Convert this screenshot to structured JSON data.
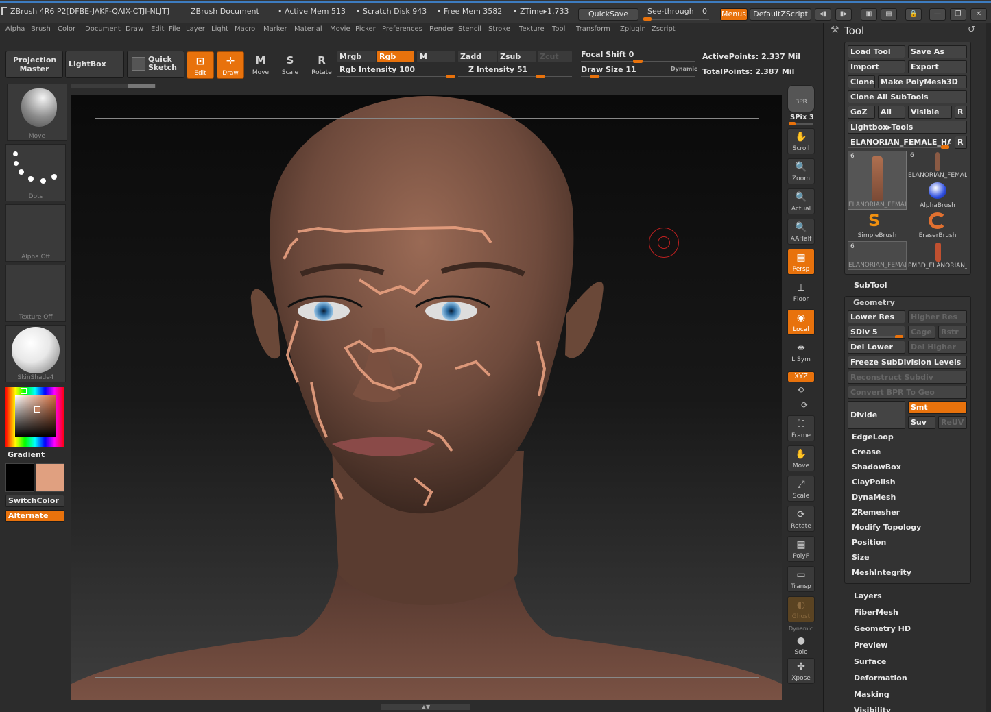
{
  "titlebar": {
    "app": "ZBrush 4R6 P2[DFBE-JAKF-QAIX-CTJI-NLJT]",
    "document": "ZBrush Document",
    "active_mem": "• Active Mem 513",
    "scratch_disk": "• Scratch Disk 943",
    "free_mem": "• Free Mem 3582",
    "ztime": "• ZTime▸1.733",
    "quicksave": "QuickSave",
    "see_through": "See-through",
    "see_through_value": "0",
    "menus": "Menus",
    "default_zscript": "DefaultZScript"
  },
  "menubar": [
    "Alpha",
    "Brush",
    "Color",
    "Document",
    "Draw",
    "Edit",
    "File",
    "Layer",
    "Light",
    "Macro",
    "Marker",
    "Material",
    "Movie",
    "Picker",
    "Preferences",
    "Render",
    "Stencil",
    "Stroke",
    "Texture",
    "Tool",
    "Transform",
    "Zplugin",
    "Zscript"
  ],
  "toolbar": {
    "projection_master": "Projection Master",
    "lightbox": "LightBox",
    "quick_sketch": "Quick Sketch",
    "edit": "Edit",
    "draw": "Draw",
    "move": "Move",
    "scale": "Scale",
    "rotate": "Rotate",
    "mrgb": "Mrgb",
    "rgb": "Rgb",
    "m": "M",
    "rgb_intensity": "Rgb Intensity 100",
    "zadd": "Zadd",
    "zsub": "Zsub",
    "zcut": "Zcut",
    "z_intensity": "Z Intensity 51",
    "focal_shift": "Focal Shift 0",
    "draw_size": "Draw Size 11",
    "dynamic": "Dynamic",
    "active_points": "ActivePoints: 2.337 Mil",
    "total_points": "TotalPoints: 2.387 Mil"
  },
  "left": {
    "brush_cap": "Move",
    "stroke_cap": "Dots",
    "alpha_cap": "Alpha Off",
    "texture_cap": "Texture Off",
    "material_cap": "SkinShade4",
    "gradient": "Gradient",
    "switch_color": "SwitchColor",
    "alternate": "Alternate",
    "main_color": "#000000",
    "secondary_color": "#e0a080"
  },
  "rshelf": {
    "bpr": "BPR",
    "spix": "SPix 3",
    "scroll": "Scroll",
    "zoom": "Zoom",
    "actual": "Actual",
    "aahalf": "AAHalf",
    "persp": "Persp",
    "floor": "Floor",
    "local": "Local",
    "lsym": "L.Sym",
    "xyz": "XYZ",
    "frame": "Frame",
    "move": "Move",
    "scale": "Scale",
    "rotate": "Rotate",
    "polyf": "PolyF",
    "transp": "Transp",
    "ghost": "Ghost",
    "dynamic": "Dynamic",
    "solo": "Solo",
    "xpose": "Xpose"
  },
  "tool": {
    "title": "Tool",
    "load_tool": "Load Tool",
    "save_as": "Save As",
    "import": "Import",
    "export": "Export",
    "clone": "Clone",
    "make_polymesh": "Make PolyMesh3D",
    "clone_all": "Clone All SubTools",
    "goz": "GoZ",
    "all": "All",
    "visible": "Visible",
    "r": "R",
    "lightbox_tools": "Lightbox▸Tools",
    "current_tool": "ELANORIAN_FEMALE_HAIR",
    "thumbs": [
      {
        "n": "6",
        "label": "ELANORIAN_FEMAL"
      },
      {
        "n": "6",
        "label": "ELANORIAN_FEMAL"
      },
      {
        "n": "",
        "label": "AlphaBrush"
      },
      {
        "n": "",
        "label": "SimpleBrush"
      },
      {
        "n": "",
        "label": "EraserBrush"
      },
      {
        "n": "6",
        "label": "ELANORIAN_FEMAL"
      },
      {
        "n": "",
        "label": "PM3D_ELANORIAN_"
      }
    ],
    "subtool": "SubTool",
    "geometry": "Geometry",
    "lower_res": "Lower Res",
    "higher_res": "Higher Res",
    "sdiv": "SDiv 5",
    "cage": "Cage",
    "rstr": "Rstr",
    "del_lower": "Del Lower",
    "del_higher": "Del Higher",
    "freeze": "Freeze SubDivision Levels",
    "reconstruct": "Reconstruct Subdiv",
    "convert_bpr": "Convert BPR To Geo",
    "divide": "Divide",
    "smt": "Smt",
    "suv": "Suv",
    "reuv": "ReUV",
    "geo_items": [
      "EdgeLoop",
      "Crease",
      "ShadowBox",
      "ClayPolish",
      "DynaMesh",
      "ZRemesher",
      "Modify Topology",
      "Position",
      "Size",
      "MeshIntegrity"
    ],
    "sections": [
      "Layers",
      "FiberMesh",
      "Geometry HD",
      "Preview",
      "Surface",
      "Deformation",
      "Masking",
      "Visibility"
    ]
  }
}
